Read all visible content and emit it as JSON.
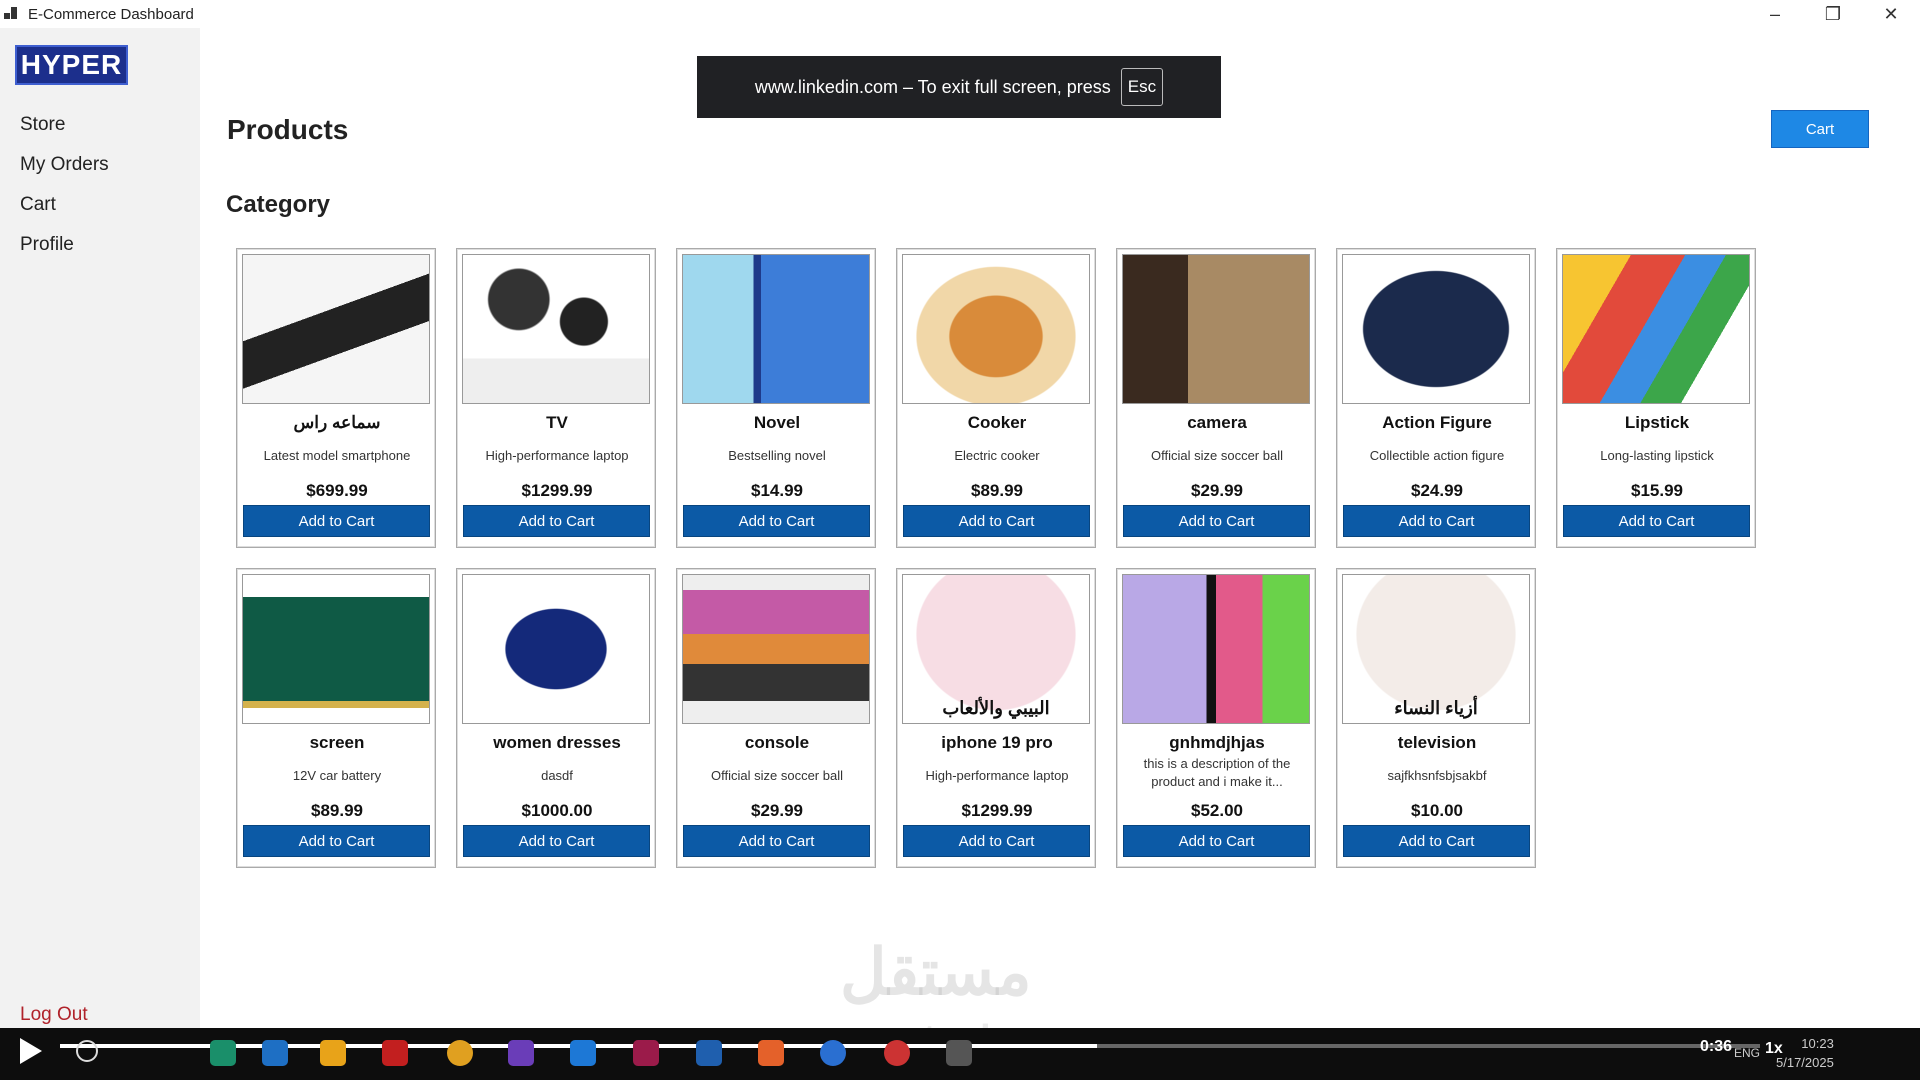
{
  "window": {
    "title": "E-Commerce Dashboard"
  },
  "sidebar": {
    "logo": "HYPER",
    "items": [
      {
        "label": "Store"
      },
      {
        "label": "My Orders"
      },
      {
        "label": "Cart"
      },
      {
        "label": "Profile"
      }
    ],
    "logout": "Log Out"
  },
  "header": {
    "title": "Products",
    "cart_button": "Cart"
  },
  "section": {
    "title": "Category"
  },
  "toast": {
    "text": "www.linkedin.com – To exit full screen, press",
    "key": "Esc"
  },
  "products": [
    {
      "name": "سماعه راس",
      "desc": "Latest model smartphone",
      "price": "$699.99",
      "button": "Add to Cart"
    },
    {
      "name": "TV",
      "desc": "High-performance laptop",
      "price": "$1299.99",
      "button": "Add to Cart"
    },
    {
      "name": "Novel",
      "desc": "Bestselling novel",
      "price": "$14.99",
      "button": "Add to Cart"
    },
    {
      "name": "Cooker",
      "desc": "Electric cooker",
      "price": "$89.99",
      "button": "Add to Cart"
    },
    {
      "name": "camera",
      "desc": "Official size soccer ball",
      "price": "$29.99",
      "button": "Add to Cart"
    },
    {
      "name": "Action Figure",
      "desc": "Collectible action figure",
      "price": "$24.99",
      "button": "Add to Cart"
    },
    {
      "name": "Lipstick",
      "desc": "Long-lasting lipstick",
      "price": "$15.99",
      "button": "Add to Cart"
    },
    {
      "name": "screen",
      "desc": "12V car battery",
      "price": "$89.99",
      "button": "Add to Cart"
    },
    {
      "name": "women dresses",
      "desc": "dasdf",
      "price": "$1000.00",
      "button": "Add to Cart"
    },
    {
      "name": "console",
      "desc": "Official size soccer ball",
      "price": "$29.99",
      "button": "Add to Cart"
    },
    {
      "name": "iphone 19 pro",
      "desc": "High-performance laptop",
      "price": "$1299.99",
      "button": "Add to Cart"
    },
    {
      "name": "gnhmdjhjas",
      "desc": "this is a description of the product and i make it...",
      "price": "$52.00",
      "button": "Add to Cart"
    },
    {
      "name": "television",
      "desc": "sajfkhsnfsbjsakbf",
      "price": "$10.00",
      "button": "Add to Cart"
    }
  ],
  "image_labels": {
    "toys": "البيبي والألعاب",
    "women": "أزياء النساء"
  },
  "watermark": {
    "arabic": "مستقل",
    "latin": "mostaql.com"
  },
  "player": {
    "time": "0:36",
    "speed": "1x",
    "progress": 0.61,
    "lang": "ENG",
    "clock_time": "10:23",
    "clock_date": "5/17/2025"
  },
  "colors": {
    "primary_button": "#0c5aa6",
    "cart_button": "#1e88e5",
    "logo_bg": "#1c2f8c",
    "logout": "#b0222a",
    "sidebar_bg": "#f2f2f2"
  }
}
